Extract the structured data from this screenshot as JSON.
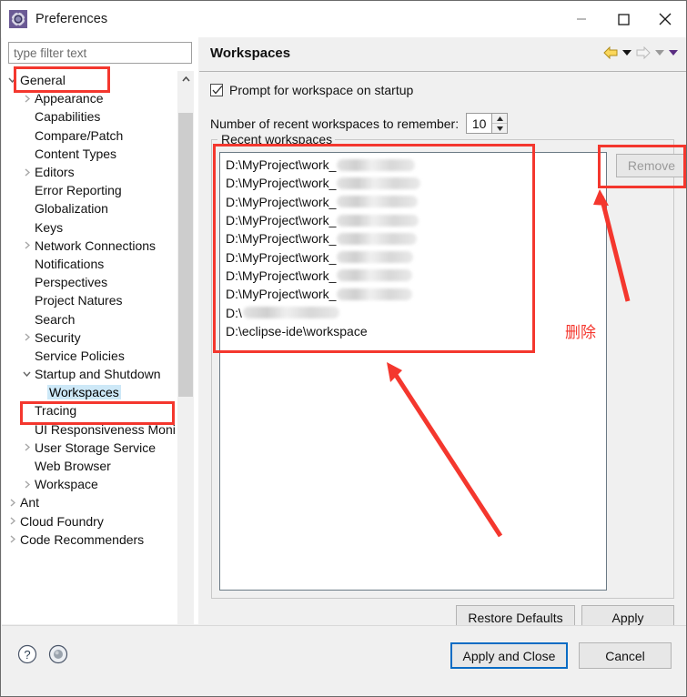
{
  "window": {
    "title": "Preferences",
    "app_icon": "gear-icon",
    "controls": {
      "minimize": "minimize-icon",
      "maximize": "maximize-icon",
      "close": "close-icon"
    }
  },
  "sidebar": {
    "filter": {
      "placeholder": "type filter text",
      "value": ""
    },
    "items": [
      {
        "label": "General",
        "indent": 0,
        "arrow": "down",
        "selected": false
      },
      {
        "label": "Appearance",
        "indent": 1,
        "arrow": "right",
        "selected": false
      },
      {
        "label": "Capabilities",
        "indent": 1,
        "arrow": "none",
        "selected": false
      },
      {
        "label": "Compare/Patch",
        "indent": 1,
        "arrow": "none",
        "selected": false
      },
      {
        "label": "Content Types",
        "indent": 1,
        "arrow": "none",
        "selected": false
      },
      {
        "label": "Editors",
        "indent": 1,
        "arrow": "right",
        "selected": false
      },
      {
        "label": "Error Reporting",
        "indent": 1,
        "arrow": "none",
        "selected": false
      },
      {
        "label": "Globalization",
        "indent": 1,
        "arrow": "none",
        "selected": false
      },
      {
        "label": "Keys",
        "indent": 1,
        "arrow": "none",
        "selected": false
      },
      {
        "label": "Network Connections",
        "indent": 1,
        "arrow": "right",
        "selected": false
      },
      {
        "label": "Notifications",
        "indent": 1,
        "arrow": "none",
        "selected": false
      },
      {
        "label": "Perspectives",
        "indent": 1,
        "arrow": "none",
        "selected": false
      },
      {
        "label": "Project Natures",
        "indent": 1,
        "arrow": "none",
        "selected": false
      },
      {
        "label": "Search",
        "indent": 1,
        "arrow": "none",
        "selected": false
      },
      {
        "label": "Security",
        "indent": 1,
        "arrow": "right",
        "selected": false
      },
      {
        "label": "Service Policies",
        "indent": 1,
        "arrow": "none",
        "selected": false
      },
      {
        "label": "Startup and Shutdown",
        "indent": 1,
        "arrow": "down",
        "selected": false
      },
      {
        "label": "Workspaces",
        "indent": 2,
        "arrow": "none",
        "selected": true
      },
      {
        "label": "Tracing",
        "indent": 1,
        "arrow": "none",
        "selected": false
      },
      {
        "label": "UI Responsiveness Monitoring",
        "indent": 1,
        "arrow": "none",
        "selected": false
      },
      {
        "label": "User Storage Service",
        "indent": 1,
        "arrow": "right",
        "selected": false
      },
      {
        "label": "Web Browser",
        "indent": 1,
        "arrow": "none",
        "selected": false
      },
      {
        "label": "Workspace",
        "indent": 1,
        "arrow": "right",
        "selected": false
      },
      {
        "label": "Ant",
        "indent": 0,
        "arrow": "right",
        "selected": false
      },
      {
        "label": "Cloud Foundry",
        "indent": 0,
        "arrow": "right",
        "selected": false
      },
      {
        "label": "Code Recommenders",
        "indent": 0,
        "arrow": "right",
        "selected": false
      }
    ],
    "scrollbar_vertical": "tree-vertical-scrollbar",
    "scrollbar_horizontal": "tree-horizontal-scrollbar"
  },
  "page": {
    "title": "Workspaces",
    "nav": [
      {
        "name": "back-arrow-icon",
        "state": "enabled"
      },
      {
        "name": "back-dropdown-icon",
        "state": "enabled"
      },
      {
        "name": "forward-arrow-icon",
        "state": "disabled"
      },
      {
        "name": "forward-dropdown-icon",
        "state": "disabled"
      },
      {
        "name": "view-menu-dropdown-icon",
        "state": "enabled"
      }
    ],
    "prompt_checkbox": {
      "label": "Prompt for workspace on startup",
      "checked": true
    },
    "recent_count": {
      "label": "Number of recent workspaces to remember:",
      "value": "10"
    },
    "group_legend": "Recent workspaces",
    "remove_button": {
      "label": "Remove",
      "enabled": false
    },
    "workspaces": [
      {
        "visible": "D:\\MyProject\\work_",
        "redacted_width": 86
      },
      {
        "visible": "D:\\MyProject\\work_",
        "redacted_width": 92
      },
      {
        "visible": "D:\\MyProject\\work_",
        "redacted_width": 89
      },
      {
        "visible": "D:\\MyProject\\work_",
        "redacted_width": 90
      },
      {
        "visible": "D:\\MyProject\\work_",
        "redacted_width": 88
      },
      {
        "visible": "D:\\MyProject\\work_",
        "redacted_width": 84
      },
      {
        "visible": "D:\\MyProject\\work_",
        "redacted_width": 83
      },
      {
        "visible": "D:\\MyProject\\work_",
        "redacted_width": 83
      },
      {
        "visible": "D:\\",
        "redacted_width": 106
      },
      {
        "visible": "D:\\eclipse-ide\\workspace",
        "redacted_width": 0
      }
    ],
    "buttons": {
      "restore_defaults": "Restore Defaults",
      "apply": "Apply"
    }
  },
  "footer": {
    "help_icon": "help-icon",
    "secondary_icon": "record-icon",
    "apply_and_close": "Apply and Close",
    "cancel": "Cancel"
  },
  "annotations": {
    "color": "#f4372e",
    "delete_label": "删除",
    "boxes": [
      "general-highlight",
      "startup-and-shutdown-highlight",
      "recent-list-highlight",
      "remove-button-highlight"
    ],
    "arrows": [
      "arrow-to-remove-button",
      "arrow-to-recent-list"
    ]
  },
  "colors": {
    "selection": "#cde8f7",
    "accent_border": "#0a6cc4",
    "annotation_red": "#f4372e",
    "panel_bg": "#f0f0f0"
  }
}
